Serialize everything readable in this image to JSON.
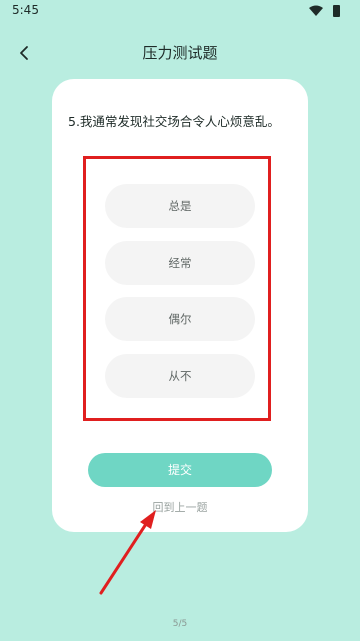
{
  "status_bar": {
    "time": "5:45",
    "icons": [
      "wifi-icon",
      "battery-icon"
    ]
  },
  "header": {
    "back_icon": "chevron-left-icon",
    "title": "压力测试题"
  },
  "question": {
    "text": "5.我通常发现社交场合令人心烦意乱。"
  },
  "options": [
    {
      "label": "总是"
    },
    {
      "label": "经常"
    },
    {
      "label": "偶尔"
    },
    {
      "label": "从不"
    }
  ],
  "actions": {
    "submit_label": "提交",
    "previous_label": "回到上一题"
  },
  "progress": {
    "indicator": "5/5"
  },
  "colors": {
    "background": "#b9ede0",
    "card": "#ffffff",
    "accent": "#6fd6c4",
    "option_bg": "#f4f4f4",
    "annotation": "#e01f1f"
  }
}
